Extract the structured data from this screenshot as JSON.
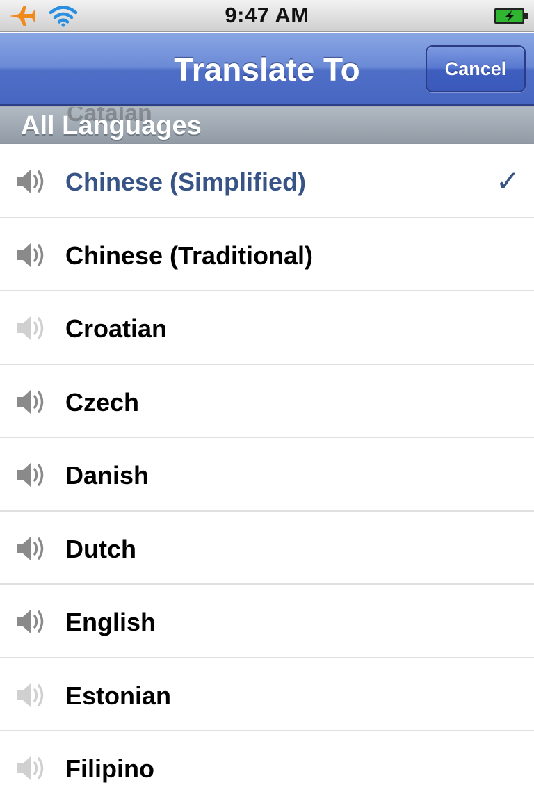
{
  "status_bar": {
    "time": "9:47 AM",
    "airplane_icon": "airplane-icon",
    "wifi_icon": "wifi-icon",
    "battery_icon": "battery-charging-icon"
  },
  "nav_bar": {
    "title": "Translate To",
    "cancel_label": "Cancel"
  },
  "section": {
    "header": "All Languages",
    "behind_text": "Catalan"
  },
  "languages": [
    {
      "name": "Chinese (Simplified)",
      "selected": true,
      "speech": true
    },
    {
      "name": "Chinese (Traditional)",
      "selected": false,
      "speech": true
    },
    {
      "name": "Croatian",
      "selected": false,
      "speech": false
    },
    {
      "name": "Czech",
      "selected": false,
      "speech": true
    },
    {
      "name": "Danish",
      "selected": false,
      "speech": true
    },
    {
      "name": "Dutch",
      "selected": false,
      "speech": true
    },
    {
      "name": "English",
      "selected": false,
      "speech": true
    },
    {
      "name": "Estonian",
      "selected": false,
      "speech": false
    },
    {
      "name": "Filipino",
      "selected": false,
      "speech": false
    }
  ],
  "checkmark": "✓",
  "colors": {
    "nav_blue": "#5b7bd0",
    "selected_text": "#385487",
    "speaker_active": "#8a8a8a",
    "speaker_inactive": "#d0d0d0",
    "airplane": "#f08a1c",
    "wifi": "#2a8fe0",
    "battery": "#2fb52f"
  }
}
